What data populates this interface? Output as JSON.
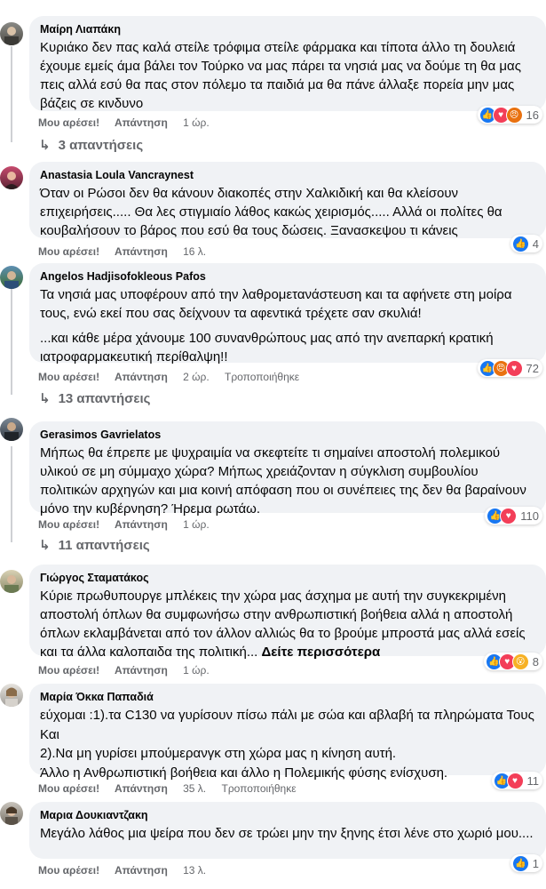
{
  "actions": {
    "like": "Μου αρέσει!",
    "reply": "Απάντηση",
    "edited": "Τροποποιήθηκε"
  },
  "comments": [
    {
      "author": "Μαίρη Λιαπάκη",
      "text": "Κυριάκο δεν πας καλά στείλε τρόφιμα στείλε φάρμακα και τίποτα άλλο τη δουλειά έχουμε εμείς άμα βάλει τον Τούρκο να μας πάρει τα νησιά μας να δούμε τη θα μας πεις αλλά εσύ θα πας στον πόλεμο τα παιδιά μα θα πάνε άλλαξε πορεία μην μας βάζεις σε κινδυνο",
      "time": "1 ώρ.",
      "reaction_count": "16",
      "reaction_icons": [
        "like-icon",
        "love-icon",
        "angry-icon"
      ],
      "replies_label": "3 απαντήσεις"
    },
    {
      "author": "Anastasia Loula Vancraynest",
      "text": "Όταν οι Ρώσοι δεν θα κάνουν διακοπές στην Χαλκιδική και θα κλείσουν επιχειρήσεις..... Θα λες στιγμιαίο λάθος κακώς χειρισμός..... Αλλά οι πολίτες θα κουβαλήσουν το βάρος που εσύ θα τους δώσεις. Ξανασκεψου τι κάνεις",
      "time": "16 λ.",
      "reaction_count": "4",
      "reaction_icons": [
        "like-icon"
      ]
    },
    {
      "author": "Angelos Hadjisofokleous Pafos",
      "text": "Τα νησιά μας υποφέρουν από την λαθρομετανάστευση και τα αφήνετε στη μοίρα τους, ενώ εκεί που σας δείχνουν τα αφεντικά τρέχετε σαν σκυλιά!",
      "text2": "...και κάθε μέρα χάνουμε 100 συνανθρώπους μας από την ανεπαρκή κρατική ιατροφαρμακευτική περίθαλψη!!",
      "time": "2 ώρ.",
      "reaction_count": "72",
      "reaction_icons": [
        "like-icon",
        "angry-icon",
        "love-icon"
      ],
      "replies_label": "13 απαντήσεις"
    },
    {
      "author": "Gerasimos Gavrielatos",
      "text": "Μήπως θα έπρεπε με ψυχραιμία να σκεφτείτε τι σημαίνει αποστολή πολεμικού υλικού σε μη σύμμαχο χώρα? Μήπως χρειάζονταν η σύγκλιση συμβουλίου πολιτικών αρχηγών και μια κοινή απόφαση που οι συνέπειες της δεν θα βαραίνουν μόνο την κυβέρνηση? Ήρεμα ρωτάω.",
      "time": "1 ώρ.",
      "reaction_count": "110",
      "reaction_icons": [
        "like-icon",
        "love-icon"
      ],
      "replies_label": "11 απαντήσεις"
    },
    {
      "author": "Γιώργος Σταματάκος",
      "text": "Κύριε πρωθυπουργε μπλέκεις την χώρα μας άσχημα με αυτή την συγκεκριμένη αποστολή όπλων θα συμφωνήσω στην ανθρωπιστική βοήθεια αλλά η αποστολή όπλων εκλαμβάνεται από τον άλλον αλλιώς θα το βρούμε μπροστά μας αλλά εσείς και τα άλλα καλοπαιδα της πολιτική...",
      "see_more": "Δείτε περισσότερα",
      "time": "1 ώρ.",
      "reaction_count": "8",
      "reaction_icons": [
        "like-icon",
        "love-icon",
        "wow-icon"
      ]
    },
    {
      "author": "Μαρία Όκκα Παπαδιά",
      "text": "εύχομαι :1).τα C130 να γυρίσουν πίσω πάλι με σώα και αβλαβή τα πληρώματα Τους Και\n2).Να μη γυρίσει μπούμερανγκ στη χώρα μας η κίνηση αυτή.\nΆλλο η Ανθρωπιστική βοήθεια και άλλο η Πολεμικής φύσης ενίσχυση.",
      "time": "35 λ.",
      "reaction_count": "11",
      "reaction_icons": [
        "like-icon",
        "love-icon"
      ]
    },
    {
      "author": "Μαρια Δουκιαντζακη",
      "text": "Μεγάλο λάθος μια ψείρα που δεν σε τρώει μην την ξηνης έτσι λένε στο χωριό μου....",
      "time": "13 λ.",
      "reaction_count": "1",
      "reaction_icons": [
        "like-icon"
      ]
    }
  ]
}
